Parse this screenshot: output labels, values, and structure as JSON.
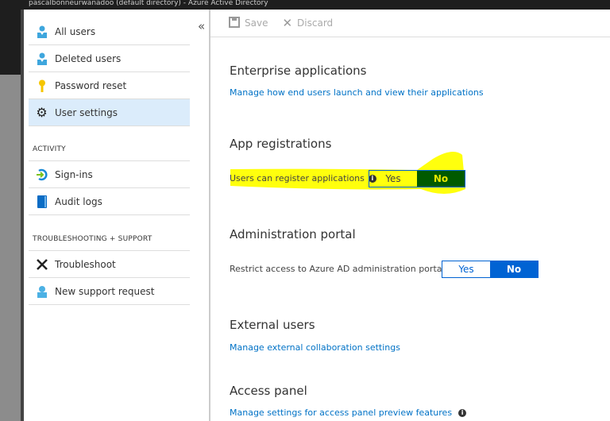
{
  "window": {
    "title": "pascalbonneurwanadoo (default directory) - Azure Active Directory"
  },
  "sidebar": {
    "collapse_icon": "«",
    "items": [
      {
        "label": "All users",
        "icon": "user-icon"
      },
      {
        "label": "Deleted users",
        "icon": "user-icon"
      },
      {
        "label": "Password reset",
        "icon": "key-icon"
      },
      {
        "label": "User settings",
        "icon": "gear-icon",
        "selected": true
      }
    ],
    "activity": {
      "title": "ACTIVITY",
      "items": [
        {
          "label": "Sign-ins",
          "icon": "sign-in-icon"
        },
        {
          "label": "Audit logs",
          "icon": "book-icon"
        }
      ]
    },
    "support": {
      "title": "TROUBLESHOOTING + SUPPORT",
      "items": [
        {
          "label": "Troubleshoot",
          "icon": "wrench-icon"
        },
        {
          "label": "New support request",
          "icon": "support-icon"
        }
      ]
    }
  },
  "toolbar": {
    "save": "Save",
    "discard": "Discard"
  },
  "main": {
    "enterprise": {
      "title": "Enterprise applications",
      "link": "Manage how end users launch and view their applications"
    },
    "app_reg": {
      "title": "App registrations",
      "label": "Users can register applications",
      "yes": "Yes",
      "no": "No",
      "selected": "No"
    },
    "admin": {
      "title": "Administration portal",
      "label": "Restrict access to Azure AD administration portal",
      "yes": "Yes",
      "no": "No",
      "selected": "No"
    },
    "external": {
      "title": "External users",
      "link": "Manage external collaboration settings"
    },
    "access": {
      "title": "Access panel",
      "link": "Manage settings for access panel preview features"
    }
  },
  "colors": {
    "accent": "#0063d3",
    "selected_bg": "#dbecfb",
    "highlight": "#ffff00",
    "highlighted_toggle": "#005a00"
  }
}
